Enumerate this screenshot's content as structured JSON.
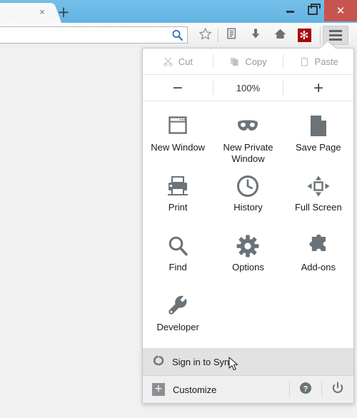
{
  "window": {
    "tab": {
      "close_label": "×",
      "close_icon": "close-icon"
    },
    "new_tab_label": "+",
    "controls": {
      "minimize_label": "",
      "restore_label": "",
      "close_label": "✕"
    }
  },
  "toolbar": {
    "search_placeholder": "",
    "search_value": "",
    "icons": [
      {
        "name": "bookmark-star-icon",
        "label": "Bookmark this page"
      },
      {
        "name": "reading-list-icon",
        "label": "Reading list"
      },
      {
        "name": "downloads-icon",
        "label": "Downloads"
      },
      {
        "name": "home-icon",
        "label": "Home"
      },
      {
        "name": "addon-asterisk-icon",
        "label": "✻",
        "color": "#a4070a"
      }
    ],
    "menu_button": {
      "name": "hamburger-menu-button",
      "label": "Open menu"
    }
  },
  "menu": {
    "edit_row": [
      {
        "label": "Cut",
        "icon": "scissors-icon",
        "disabled": true
      },
      {
        "label": "Copy",
        "icon": "copy-icon",
        "disabled": true
      },
      {
        "label": "Paste",
        "icon": "clipboard-icon",
        "disabled": true
      }
    ],
    "zoom_row": {
      "minus_label": "−",
      "level": "100%",
      "plus_label": "+"
    },
    "grid": [
      {
        "label": "New Window",
        "icon": "new-window-icon"
      },
      {
        "label": "New Private Window",
        "icon": "mask-icon"
      },
      {
        "label": "Save Page",
        "icon": "page-icon"
      },
      {
        "label": "Print",
        "icon": "printer-icon"
      },
      {
        "label": "History",
        "icon": "clock-icon"
      },
      {
        "label": "Full Screen",
        "icon": "fullscreen-arrows-icon"
      },
      {
        "label": "Find",
        "icon": "magnifier-icon"
      },
      {
        "label": "Options",
        "icon": "gear-icon"
      },
      {
        "label": "Add-ons",
        "icon": "puzzle-icon"
      },
      {
        "label": "Developer",
        "icon": "wrench-icon"
      }
    ],
    "sync": {
      "label": "Sign in to Sync",
      "icon": "sync-icon"
    },
    "footer": {
      "customize_label": "Customize",
      "customize_icon": "plus-box-icon",
      "help_icon": "help-circle-icon",
      "quit_icon": "power-icon"
    }
  },
  "colors": {
    "titlebar": "#6cb9e8",
    "close_button": "#c75450",
    "addon_badge": "#a4070a",
    "icon_gray": "#6b7378",
    "panel_bg": "#ffffff",
    "sync_row_bg": "#e2e2e2"
  }
}
